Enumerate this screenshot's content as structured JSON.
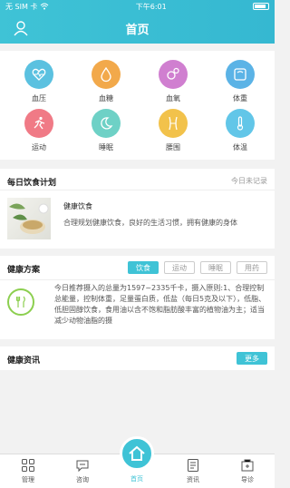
{
  "status": {
    "carrier": "无 SIM 卡",
    "time": "下午6:01"
  },
  "header": {
    "title": "首页",
    "user_icon": "user-icon"
  },
  "metrics": [
    {
      "label": "血压",
      "icon": "heartbeat-icon",
      "color": "#5bc1e0"
    },
    {
      "label": "血糖",
      "icon": "drop-icon",
      "color": "#f2a94b"
    },
    {
      "label": "血氧",
      "icon": "oxygen-icon",
      "color": "#d07fd0"
    },
    {
      "label": "体重",
      "icon": "scale-icon",
      "color": "#5bb3e6"
    },
    {
      "label": "运动",
      "icon": "run-icon",
      "color": "#f07a86"
    },
    {
      "label": "睡眠",
      "icon": "moon-icon",
      "color": "#6ed1c6"
    },
    {
      "label": "腰围",
      "icon": "waist-icon",
      "color": "#f2c24b"
    },
    {
      "label": "体温",
      "icon": "thermometer-icon",
      "color": "#62c6e8"
    }
  ],
  "plan": {
    "title": "每日饮食计划",
    "status": "今日未记录",
    "item_name": "健康饮食",
    "item_desc": "合理规划健康饮食，良好的生活习惯，拥有健康的身体"
  },
  "scheme": {
    "title": "健康方案",
    "tabs": [
      "饮食",
      "运动",
      "睡眠",
      "用药"
    ],
    "active_tab": "饮食",
    "text": "今日推荐摄入的总量为1597~2335千卡，摄入原则:1、合理控制总能量，控制体重，足量蛋白质，低盐（每日5克及以下），低脂、低胆固醇饮食，食用油以含不饱和脂肪酸丰富的植物油为主；适当减少动物油脂的摄"
  },
  "news": {
    "title": "健康资讯",
    "more": "更多"
  },
  "nav": {
    "items": [
      "管理",
      "咨询",
      "首页",
      "资讯",
      "导诊"
    ],
    "active": "首页"
  }
}
